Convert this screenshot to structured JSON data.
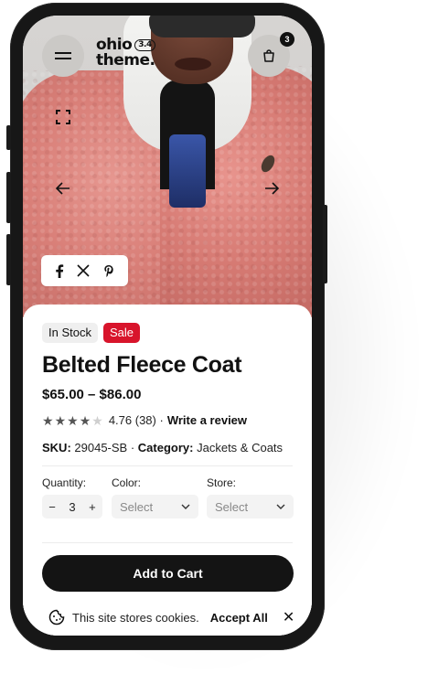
{
  "header": {
    "logo_text": "ohio theme.",
    "logo_version": "3.4",
    "cart_count": "3"
  },
  "badges": {
    "stock": "In Stock",
    "sale": "Sale"
  },
  "product": {
    "title": "Belted Fleece Coat",
    "price": "$65.00 – $86.00",
    "rating_value": "4.76",
    "rating_count": "(38)",
    "rating_stars": 4,
    "review_link": "Write a review",
    "sku_label": "SKU:",
    "sku_value": "29045-SB",
    "category_label": "Category:",
    "category_value": "Jackets & Coats"
  },
  "options": {
    "quantity_label": "Quantity:",
    "quantity_value": "3",
    "color_label": "Color:",
    "color_value": "Select",
    "store_label": "Store:",
    "store_value": "Select"
  },
  "cart_button": "Add to Cart",
  "cookie": {
    "message": "This site stores cookies.",
    "accept": "Accept All"
  },
  "icons": [
    "menu-icon",
    "bag-icon",
    "expand-icon",
    "arrow-left-icon",
    "arrow-right-icon",
    "facebook-icon",
    "x-icon",
    "pinterest-icon",
    "cookie-icon",
    "close-icon"
  ],
  "colors": {
    "sale": "#d8142b",
    "cart_button": "#141414"
  }
}
